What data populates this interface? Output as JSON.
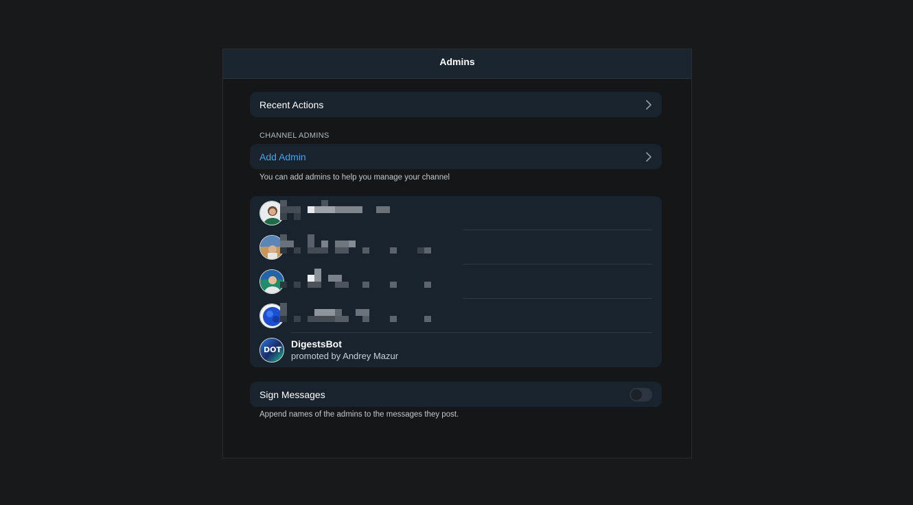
{
  "header": {
    "title": "Admins"
  },
  "recent_actions": {
    "label": "Recent Actions",
    "icon": "chevron-right-icon"
  },
  "channel_admins": {
    "section_title": "CHANNEL ADMINS",
    "add_admin_label": "Add Admin",
    "add_admin_footnote": "You can add admins to help you manage your channel"
  },
  "admins": [
    {
      "avatar": "avatar-woman-green",
      "redacted": true
    },
    {
      "avatar": "avatar-man-desert",
      "redacted": true
    },
    {
      "avatar": "avatar-man-green-bg",
      "redacted": true
    },
    {
      "avatar": "avatar-blue-pixel",
      "redacted": true
    },
    {
      "avatar": "avatar-dot-logo",
      "name": "DigestsBot",
      "subtitle": "promoted by Andrey Mazur"
    }
  ],
  "sign_messages": {
    "label": "Sign Messages",
    "enabled": false,
    "footnote": "Append names of the admins to the messages they post."
  },
  "colors": {
    "background": "#18191b",
    "card": "#19232e",
    "accent": "#3ea6f2",
    "header": "#1a2530"
  }
}
